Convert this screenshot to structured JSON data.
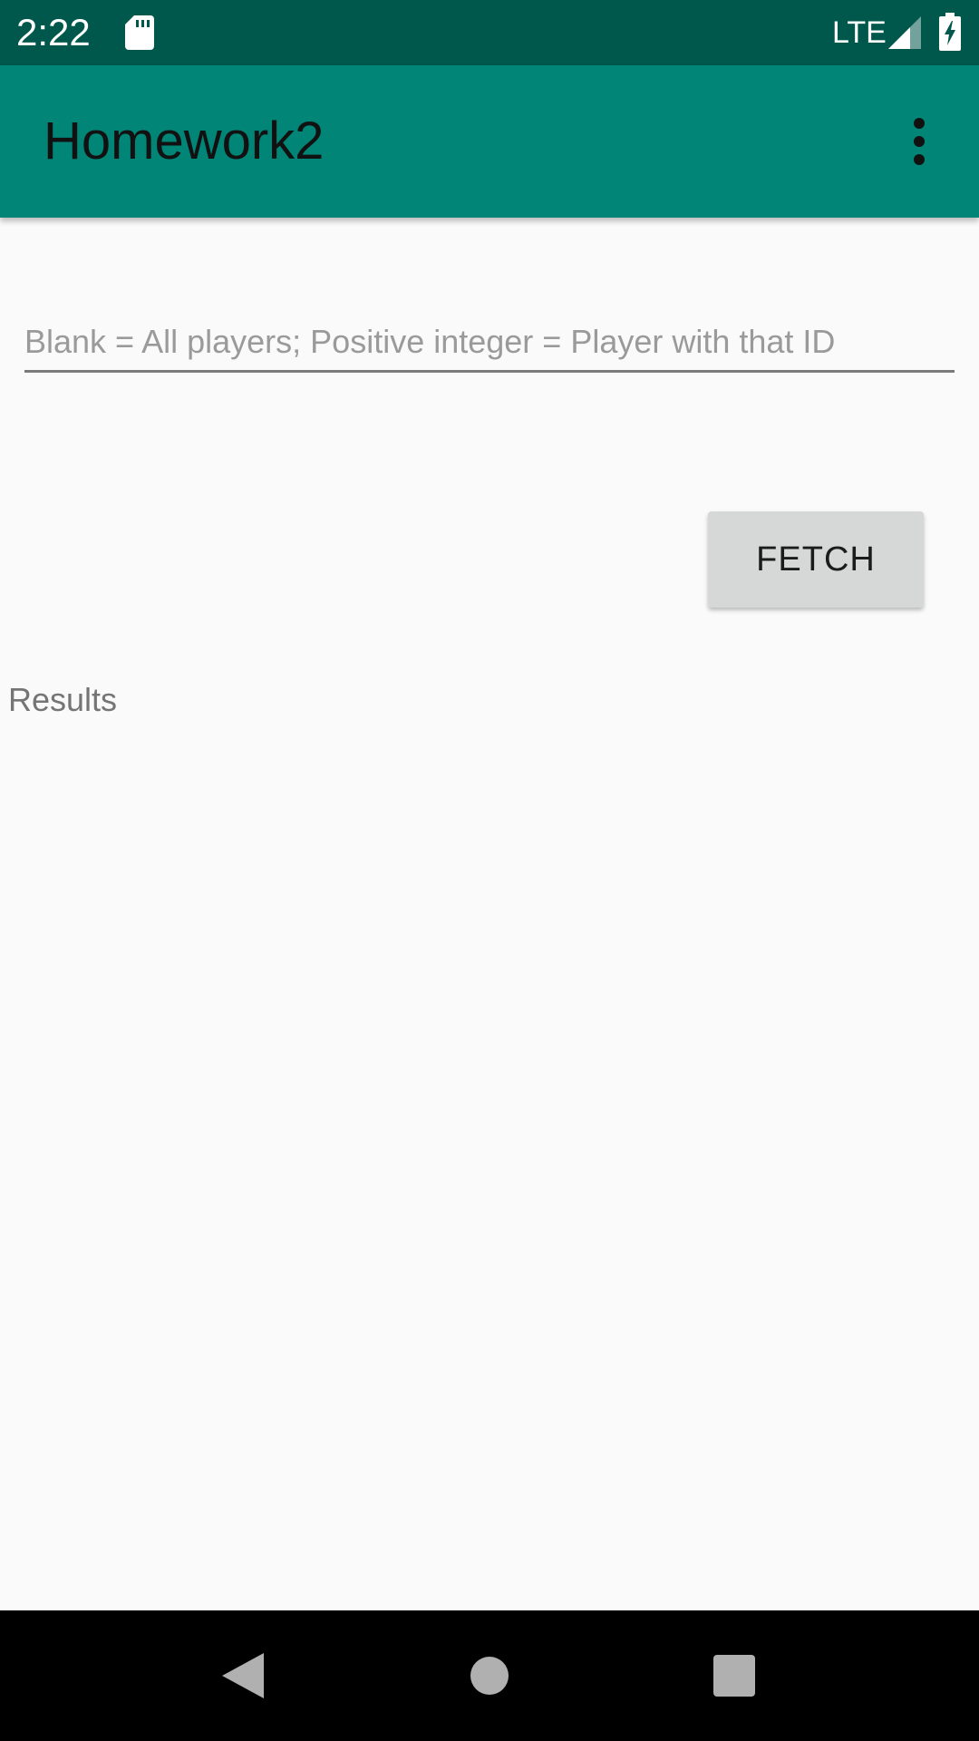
{
  "status_bar": {
    "time": "2:22",
    "network": "LTE",
    "icons": [
      "sd-card-icon",
      "signal-icon",
      "battery-charging-icon"
    ],
    "background_color": "#00574b"
  },
  "app_bar": {
    "title": "Homework2",
    "overflow_icon": "more-vert-icon",
    "background_color": "#008577"
  },
  "input": {
    "value": "",
    "placeholder": "Blank = All players; Positive integer = Player with that ID"
  },
  "fetch_button": {
    "label": "FETCH"
  },
  "results": {
    "label": "Results"
  },
  "nav_bar": {
    "icons": [
      "back-icon",
      "home-icon",
      "recents-icon"
    ]
  }
}
